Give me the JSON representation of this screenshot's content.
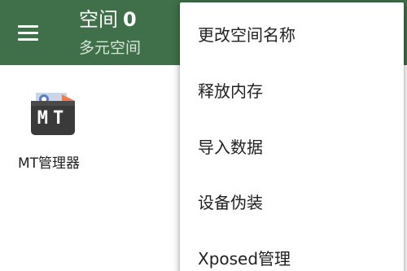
{
  "header": {
    "title": "空间",
    "space_number": "0",
    "subtitle": "多元空间",
    "background_color": "#3f7049",
    "menu_icon": "hamburger-menu-icon"
  },
  "apps": [
    {
      "label": "MT管理器",
      "icon": "mt-manager-app-icon",
      "icon_text": "MT"
    }
  ],
  "menu": {
    "items": [
      {
        "label": "更改空间名称"
      },
      {
        "label": "释放内存"
      },
      {
        "label": "导入数据"
      },
      {
        "label": "设备伪装"
      },
      {
        "label": "Xposed管理"
      }
    ]
  }
}
